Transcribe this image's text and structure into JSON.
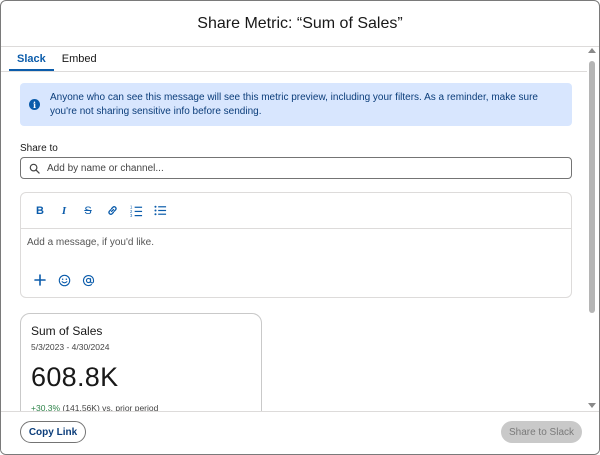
{
  "modal": {
    "title": "Share Metric: “Sum of Sales”"
  },
  "tabs": [
    {
      "label": "Slack",
      "active": true
    },
    {
      "label": "Embed",
      "active": false
    }
  ],
  "info_banner": {
    "icon": "info-icon",
    "text": "Anyone who can see this message will see this metric preview, including your filters. As a reminder, make sure you're not sharing sensitive info before sending."
  },
  "share_to": {
    "label": "Share to",
    "placeholder": "Add by name or channel..."
  },
  "composer": {
    "toolbar": [
      "bold-icon",
      "italic-icon",
      "strikethrough-icon",
      "link-icon",
      "numbered-list-icon",
      "bulleted-list-icon"
    ],
    "placeholder": "Add a message, if you'd like.",
    "actions": [
      "plus-icon",
      "emoji-icon",
      "mention-icon"
    ]
  },
  "metric_card": {
    "name": "Sum of Sales",
    "dates": "5/3/2023 - 4/30/2024",
    "value": "608.8K",
    "change_pct": "+30.3%",
    "change_detail": "(141.56K) vs. prior period"
  },
  "footer": {
    "copy_link_label": "Copy Link",
    "share_label": "Share to Slack"
  },
  "colors": {
    "accent": "#0b5cab",
    "banner_bg": "#d8e6fe",
    "positive": "#2e844a",
    "disabled_bg": "#c9c9c9"
  }
}
